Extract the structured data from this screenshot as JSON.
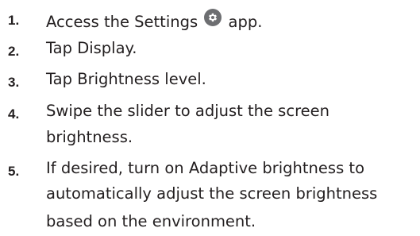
{
  "instructions": {
    "steps": [
      {
        "number": "1.",
        "text_before_icon": "Access the Settings",
        "icon": "settings-gear-icon",
        "text_after_icon": "app."
      },
      {
        "number": "2.",
        "text": "Tap Display."
      },
      {
        "number": "3.",
        "text": "Tap Brightness level."
      },
      {
        "number": "4.",
        "line1": "Swipe the slider to adjust the screen",
        "line2": "brightness."
      },
      {
        "number": "5.",
        "line1": "If desired, turn on Adaptive brightness to",
        "line2": "automatically adjust the screen brightness",
        "line3": "based on the environment."
      }
    ]
  },
  "colors": {
    "text": "#231f20",
    "icon_badge": "#6d6e71"
  }
}
